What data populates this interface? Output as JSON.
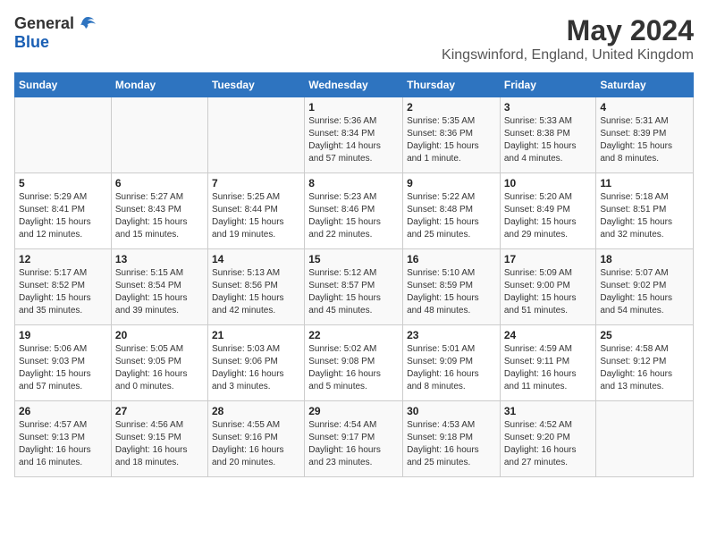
{
  "header": {
    "logo_general": "General",
    "logo_blue": "Blue",
    "main_title": "May 2024",
    "subtitle": "Kingswinford, England, United Kingdom"
  },
  "days_of_week": [
    "Sunday",
    "Monday",
    "Tuesday",
    "Wednesday",
    "Thursday",
    "Friday",
    "Saturday"
  ],
  "weeks": [
    [
      {
        "day": "",
        "info": ""
      },
      {
        "day": "",
        "info": ""
      },
      {
        "day": "",
        "info": ""
      },
      {
        "day": "1",
        "info": "Sunrise: 5:36 AM\nSunset: 8:34 PM\nDaylight: 14 hours\nand 57 minutes."
      },
      {
        "day": "2",
        "info": "Sunrise: 5:35 AM\nSunset: 8:36 PM\nDaylight: 15 hours\nand 1 minute."
      },
      {
        "day": "3",
        "info": "Sunrise: 5:33 AM\nSunset: 8:38 PM\nDaylight: 15 hours\nand 4 minutes."
      },
      {
        "day": "4",
        "info": "Sunrise: 5:31 AM\nSunset: 8:39 PM\nDaylight: 15 hours\nand 8 minutes."
      }
    ],
    [
      {
        "day": "5",
        "info": "Sunrise: 5:29 AM\nSunset: 8:41 PM\nDaylight: 15 hours\nand 12 minutes."
      },
      {
        "day": "6",
        "info": "Sunrise: 5:27 AM\nSunset: 8:43 PM\nDaylight: 15 hours\nand 15 minutes."
      },
      {
        "day": "7",
        "info": "Sunrise: 5:25 AM\nSunset: 8:44 PM\nDaylight: 15 hours\nand 19 minutes."
      },
      {
        "day": "8",
        "info": "Sunrise: 5:23 AM\nSunset: 8:46 PM\nDaylight: 15 hours\nand 22 minutes."
      },
      {
        "day": "9",
        "info": "Sunrise: 5:22 AM\nSunset: 8:48 PM\nDaylight: 15 hours\nand 25 minutes."
      },
      {
        "day": "10",
        "info": "Sunrise: 5:20 AM\nSunset: 8:49 PM\nDaylight: 15 hours\nand 29 minutes."
      },
      {
        "day": "11",
        "info": "Sunrise: 5:18 AM\nSunset: 8:51 PM\nDaylight: 15 hours\nand 32 minutes."
      }
    ],
    [
      {
        "day": "12",
        "info": "Sunrise: 5:17 AM\nSunset: 8:52 PM\nDaylight: 15 hours\nand 35 minutes."
      },
      {
        "day": "13",
        "info": "Sunrise: 5:15 AM\nSunset: 8:54 PM\nDaylight: 15 hours\nand 39 minutes."
      },
      {
        "day": "14",
        "info": "Sunrise: 5:13 AM\nSunset: 8:56 PM\nDaylight: 15 hours\nand 42 minutes."
      },
      {
        "day": "15",
        "info": "Sunrise: 5:12 AM\nSunset: 8:57 PM\nDaylight: 15 hours\nand 45 minutes."
      },
      {
        "day": "16",
        "info": "Sunrise: 5:10 AM\nSunset: 8:59 PM\nDaylight: 15 hours\nand 48 minutes."
      },
      {
        "day": "17",
        "info": "Sunrise: 5:09 AM\nSunset: 9:00 PM\nDaylight: 15 hours\nand 51 minutes."
      },
      {
        "day": "18",
        "info": "Sunrise: 5:07 AM\nSunset: 9:02 PM\nDaylight: 15 hours\nand 54 minutes."
      }
    ],
    [
      {
        "day": "19",
        "info": "Sunrise: 5:06 AM\nSunset: 9:03 PM\nDaylight: 15 hours\nand 57 minutes."
      },
      {
        "day": "20",
        "info": "Sunrise: 5:05 AM\nSunset: 9:05 PM\nDaylight: 16 hours\nand 0 minutes."
      },
      {
        "day": "21",
        "info": "Sunrise: 5:03 AM\nSunset: 9:06 PM\nDaylight: 16 hours\nand 3 minutes."
      },
      {
        "day": "22",
        "info": "Sunrise: 5:02 AM\nSunset: 9:08 PM\nDaylight: 16 hours\nand 5 minutes."
      },
      {
        "day": "23",
        "info": "Sunrise: 5:01 AM\nSunset: 9:09 PM\nDaylight: 16 hours\nand 8 minutes."
      },
      {
        "day": "24",
        "info": "Sunrise: 4:59 AM\nSunset: 9:11 PM\nDaylight: 16 hours\nand 11 minutes."
      },
      {
        "day": "25",
        "info": "Sunrise: 4:58 AM\nSunset: 9:12 PM\nDaylight: 16 hours\nand 13 minutes."
      }
    ],
    [
      {
        "day": "26",
        "info": "Sunrise: 4:57 AM\nSunset: 9:13 PM\nDaylight: 16 hours\nand 16 minutes."
      },
      {
        "day": "27",
        "info": "Sunrise: 4:56 AM\nSunset: 9:15 PM\nDaylight: 16 hours\nand 18 minutes."
      },
      {
        "day": "28",
        "info": "Sunrise: 4:55 AM\nSunset: 9:16 PM\nDaylight: 16 hours\nand 20 minutes."
      },
      {
        "day": "29",
        "info": "Sunrise: 4:54 AM\nSunset: 9:17 PM\nDaylight: 16 hours\nand 23 minutes."
      },
      {
        "day": "30",
        "info": "Sunrise: 4:53 AM\nSunset: 9:18 PM\nDaylight: 16 hours\nand 25 minutes."
      },
      {
        "day": "31",
        "info": "Sunrise: 4:52 AM\nSunset: 9:20 PM\nDaylight: 16 hours\nand 27 minutes."
      },
      {
        "day": "",
        "info": ""
      }
    ]
  ]
}
